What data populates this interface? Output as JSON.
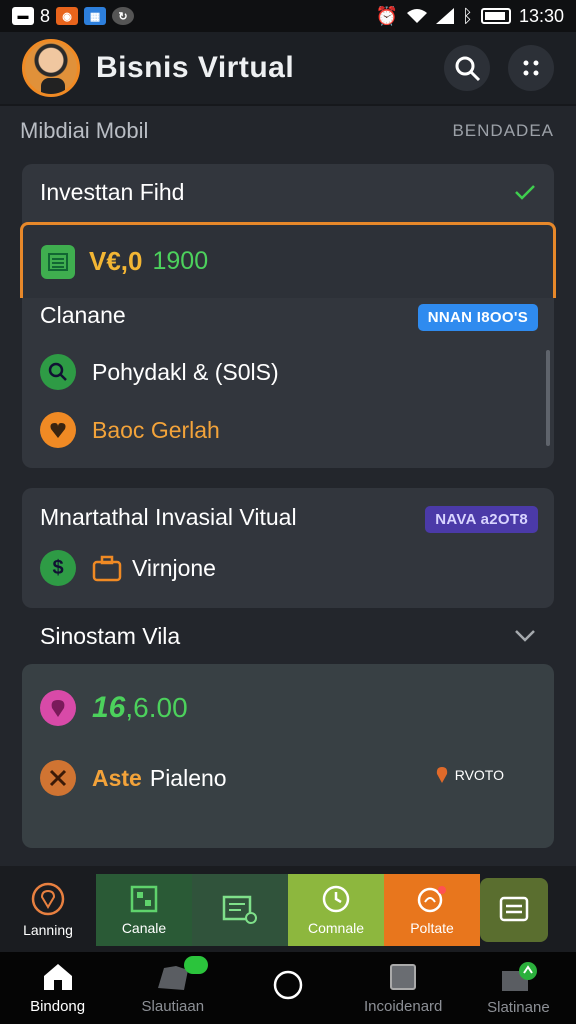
{
  "statusbar": {
    "left_icons": [
      "notification-icon",
      "badge-icon",
      "app-icon",
      "sync-icon"
    ],
    "left_count": "8",
    "time": "13:30"
  },
  "appbar": {
    "title": "Bisnis Virtual",
    "search_icon": "search-icon",
    "menu_icon": "more-icon"
  },
  "section": {
    "title": "Mibdiai Mobil",
    "link": "BENDADEA"
  },
  "card1": {
    "title": "Investtan Fihd",
    "highlight_value": "V€,0",
    "highlight_value2": "1900",
    "row1_label": "Clanane",
    "row1_badge": "NNAN I8OO'S",
    "row2_label": "Pohydakl & (S0lS)",
    "row3_label": "Baoc Gerlah"
  },
  "card2": {
    "title": "Mnartathal Invasial Vitual",
    "badge": "NAVA a2OT8",
    "row_label": "Virnjone"
  },
  "subsection": {
    "title": "Sinostam Vila"
  },
  "card3": {
    "value_a": "16",
    "value_b": ",6.00",
    "row_label_a": "Aste",
    "row_label_b": "Pialeno",
    "row_right": "RVOTO"
  },
  "toolbar": {
    "items": [
      {
        "label": "Lanning",
        "color": "#1a1c20",
        "icon": "pin-icon"
      },
      {
        "label": "Canale",
        "color": "#2a5a36",
        "icon": "grid-icon"
      },
      {
        "label": "",
        "color": "#30533b",
        "icon": "document-icon"
      },
      {
        "label": "Comnale",
        "color": "#8db73e",
        "icon": "clock-icon"
      },
      {
        "label": "Poltate",
        "color": "#e8761d",
        "icon": "bell-icon"
      },
      {
        "label": "",
        "color": "#5a6e2f",
        "icon": "list-icon"
      }
    ]
  },
  "navbar": {
    "items": [
      {
        "label": "Bindong",
        "icon": "home-icon"
      },
      {
        "label": "Slautiaan",
        "icon": "map-icon"
      },
      {
        "label": "",
        "icon": "circle-icon"
      },
      {
        "label": "Incoidenard",
        "icon": "square-icon"
      },
      {
        "label": "Slatinane",
        "icon": "store-icon"
      }
    ]
  },
  "colors": {
    "accent_orange": "#e7882a",
    "accent_green": "#4cd15c",
    "accent_blue": "#2f8bef",
    "accent_purple": "#4b3aa8"
  }
}
